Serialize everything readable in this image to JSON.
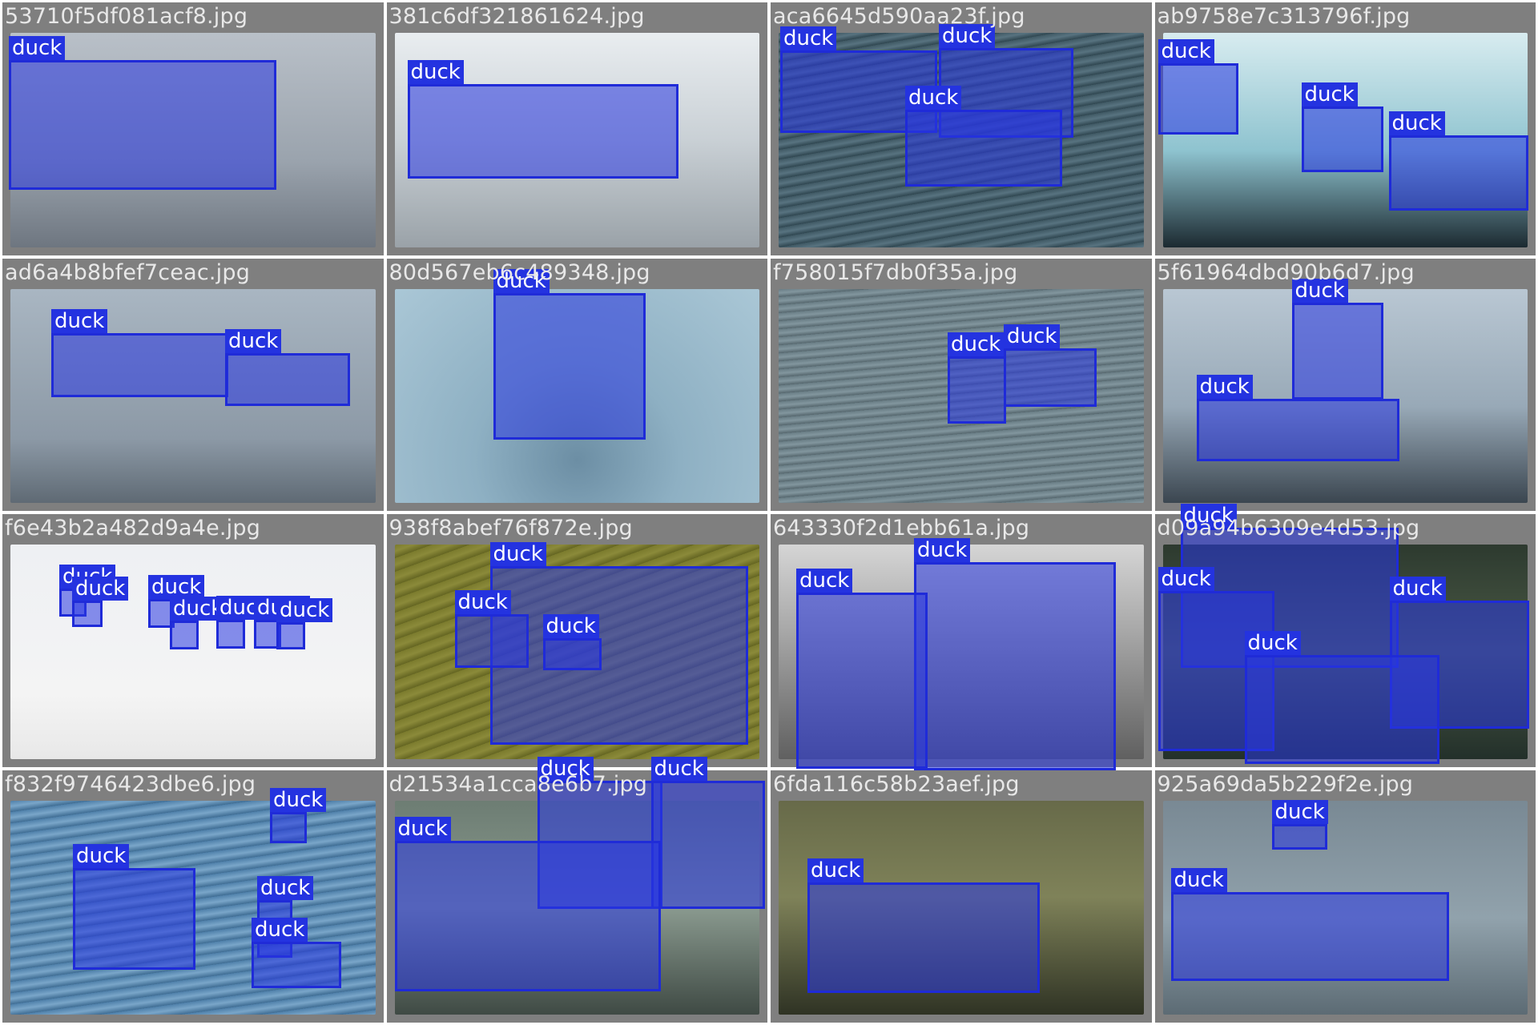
{
  "detection_label": "duck",
  "box_color": "#2433e0",
  "tiles": [
    {
      "filename": "53710f5df081acf8.jpg",
      "labels": [
        "duck"
      ]
    },
    {
      "filename": "381c6df321861624.jpg",
      "labels": [
        "duck"
      ]
    },
    {
      "filename": "aca6645d590aa23f.jpg",
      "labels": [
        "duck",
        "duck",
        "duck"
      ]
    },
    {
      "filename": "ab9758e7c313796f.jpg",
      "labels": [
        "duck",
        "duck",
        "duck"
      ]
    },
    {
      "filename": "ad6a4b8bfef7ceac.jpg",
      "labels": [
        "duck",
        "duck"
      ]
    },
    {
      "filename": "80d567eb6c489348.jpg",
      "labels": [
        "duck"
      ]
    },
    {
      "filename": "f758015f7db0f35a.jpg",
      "labels": [
        "duck",
        "duck"
      ]
    },
    {
      "filename": "5f61964dbd90b6d7.jpg",
      "labels": [
        "duck",
        "duck"
      ]
    },
    {
      "filename": "f6e43b2a482d9a4e.jpg",
      "labels": [
        "duck",
        "duck",
        "duck",
        "duck",
        "duck",
        "duck",
        "duck"
      ]
    },
    {
      "filename": "938f8abef76f872e.jpg",
      "labels": [
        "duck",
        "duck",
        "duck"
      ]
    },
    {
      "filename": "643330f2d1ebb61a.jpg",
      "labels": [
        "duck",
        "duck"
      ]
    },
    {
      "filename": "d09a94b6309e4d53.jpg",
      "labels": [
        "duck",
        "duck",
        "duck",
        "duck"
      ]
    },
    {
      "filename": "f832f9746423dbe6.jpg",
      "labels": [
        "duck",
        "duck",
        "duck",
        "duck"
      ]
    },
    {
      "filename": "d21534a1cca8e6b7.jpg",
      "labels": [
        "duck",
        "duck",
        "duck"
      ]
    },
    {
      "filename": "6fda116c58b23aef.jpg",
      "labels": [
        "duck"
      ]
    },
    {
      "filename": "925a69da5b229f2e.jpg",
      "labels": [
        "duck",
        "duck"
      ]
    }
  ]
}
